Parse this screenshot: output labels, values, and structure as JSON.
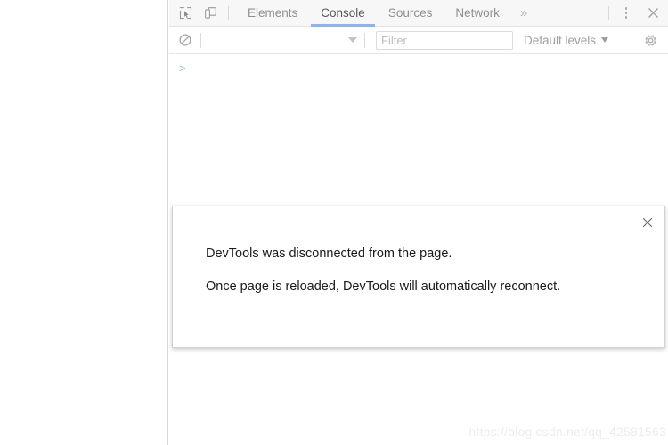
{
  "window": {
    "page_area_label": "inspected-page-blank-area",
    "background_color": "#ffffff"
  },
  "devtools": {
    "tabstrip": {
      "inspect_icon": "inspect-element-icon",
      "device_icon": "device-toolbar-icon",
      "tabs": [
        {
          "label": "Elements",
          "active": false
        },
        {
          "label": "Console",
          "active": true
        },
        {
          "label": "Sources",
          "active": false
        },
        {
          "label": "Network",
          "active": false
        }
      ],
      "overflow_label": "»",
      "more_icon": "kebab-menu-icon",
      "close_icon": "close-icon",
      "active_tab_underline_color": "#8ab4f8",
      "tab_text_color": "#8f8f8f",
      "active_tab_text_color": "#5a5a5a",
      "background_color": "#f7f7f7"
    },
    "toolbar": {
      "clear_icon": "clear-console-icon",
      "context_selector_value": "",
      "context_selector_caret": "chevron-down-icon",
      "filter": {
        "placeholder": "Filter",
        "value": ""
      },
      "levels_label": "Default levels",
      "levels_caret": "chevron-down-icon",
      "settings_icon": "gear-icon"
    },
    "console": {
      "prompt_symbol": ">",
      "prompt_color": "#9cb8f2",
      "messages": []
    },
    "dialog": {
      "close_label": "×",
      "lines": [
        "DevTools was disconnected from the page.",
        "Once page is reloaded, DevTools will automatically reconnect."
      ]
    }
  },
  "watermark": {
    "text": "https://blog.csdn.net/qq_42581563",
    "color": "#ededed"
  }
}
